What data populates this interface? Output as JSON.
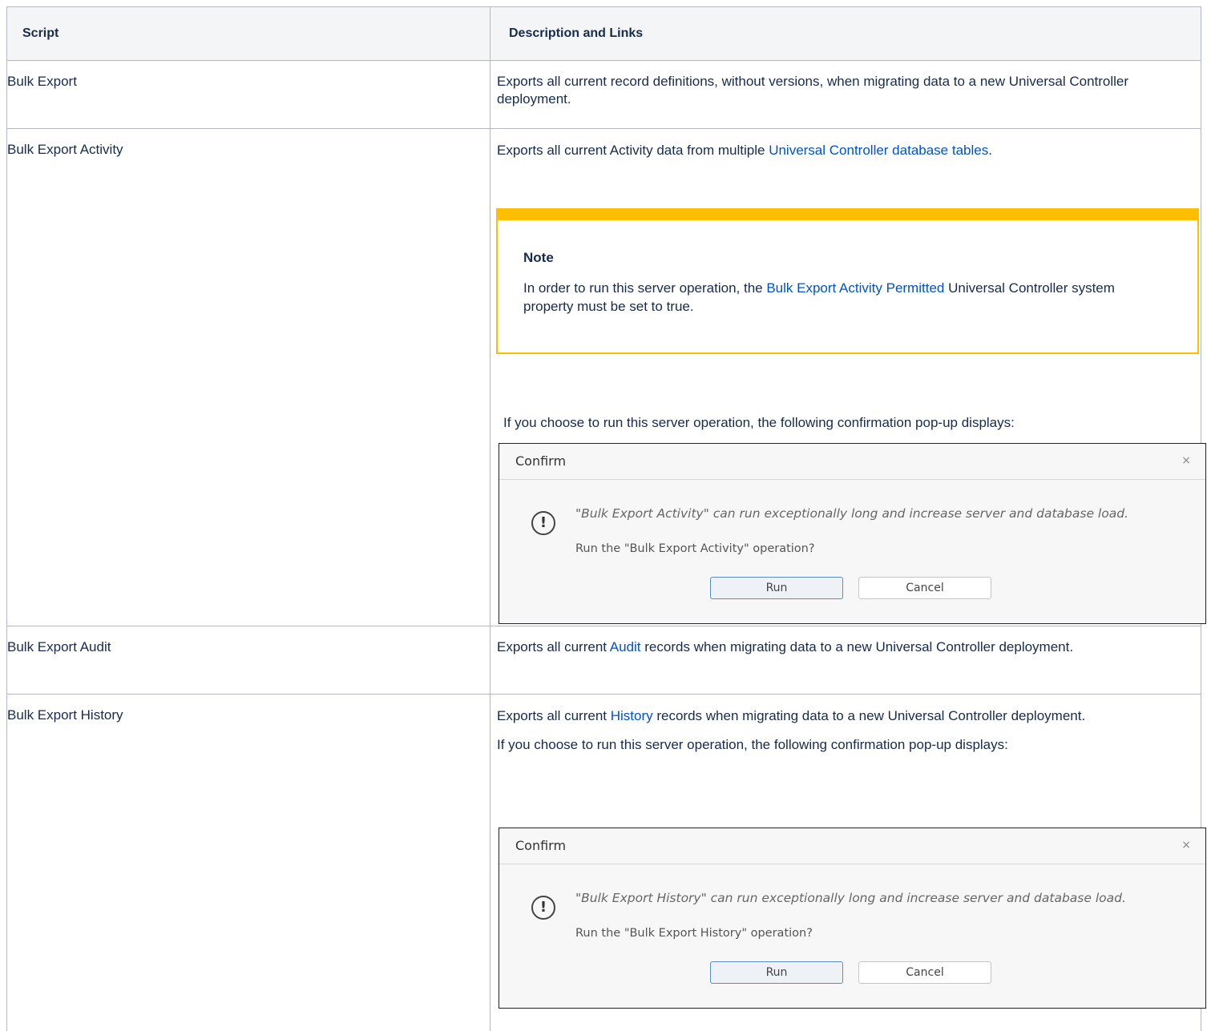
{
  "header": {
    "script": "Script",
    "description": "Description and Links"
  },
  "rows": [
    {
      "name": "Bulk Export",
      "text": "Exports all current record definitions, without versions, when migrating data to a new Universal Controller deployment."
    },
    {
      "name": "Bulk Export Activity",
      "text_before": "Exports all current Activity data from multiple ",
      "link": "Universal Controller database tables",
      "text_after": ".",
      "note": {
        "title": "Note",
        "before": "In order to run this server operation, the ",
        "link": "Bulk Export Activity Permitted",
        "after": " Universal Controller system property must be set to true."
      },
      "popup_intro": "If you choose to run this server operation, the following confirmation pop-up displays:",
      "dialog": {
        "title": "Confirm",
        "close": "×",
        "message": "\"Bulk Export Activity\" can run exceptionally long and increase server and database load.",
        "question": "Run the \"Bulk Export Activity\" operation?",
        "run": "Run",
        "cancel": "Cancel"
      }
    },
    {
      "name": "Bulk Export Audit",
      "before": "Exports all current ",
      "link": "Audit",
      "after": " records when migrating data to a new Universal Controller deployment."
    },
    {
      "name": "Bulk Export History",
      "before": "Exports all current ",
      "link": "History",
      "after": " records when migrating data to a new Universal Controller deployment.",
      "popup_intro": "If you choose to run this server operation, the following confirmation pop-up displays:",
      "dialog": {
        "title": "Confirm",
        "close": "×",
        "message": "\"Bulk Export History\" can run exceptionally long and increase server and database load.",
        "question": "Run the \"Bulk Export History\" operation?",
        "run": "Run",
        "cancel": "Cancel"
      }
    }
  ]
}
